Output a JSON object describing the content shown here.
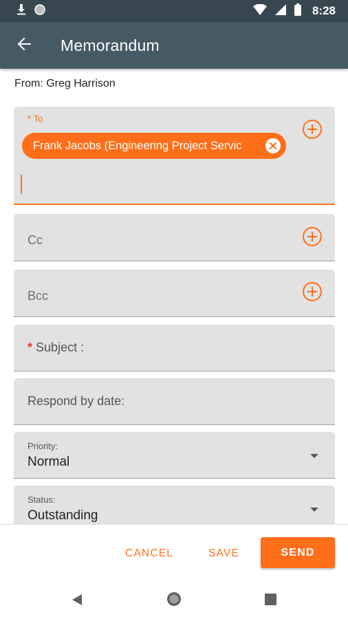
{
  "status_bar": {
    "time": "8:28",
    "icons": [
      "download-icon",
      "circle-icon",
      "wifi-icon",
      "signal-icon",
      "battery-icon"
    ]
  },
  "app_bar": {
    "title": "Memorandum",
    "back_icon": "arrow-left-icon"
  },
  "from": "From: Greg Harrison",
  "to_field": {
    "required_mark": "*",
    "label": "To",
    "recipients": [
      "Frank Jacobs (Engineering Project Servic"
    ],
    "add_icon": "add-circle-icon"
  },
  "cc_field": {
    "label": "Cc",
    "add_icon": "add-circle-icon"
  },
  "bcc_field": {
    "label": "Bcc",
    "add_icon": "add-circle-icon"
  },
  "subject_field": {
    "required_mark": "*",
    "label": "Subject :"
  },
  "respond_field": {
    "label": "Respond by date:"
  },
  "priority_field": {
    "label": "Priority:",
    "value": "Normal"
  },
  "status_field": {
    "label": "Status:",
    "value": "Outstanding"
  },
  "actions": {
    "cancel": "CANCEL",
    "save": "SAVE",
    "send": "SEND"
  },
  "colors": {
    "accent": "#ff6f1a",
    "app_bar": "#455a64",
    "status_bar": "#37474f",
    "field_bg": "#e2e2e2",
    "required": "#e53935"
  }
}
